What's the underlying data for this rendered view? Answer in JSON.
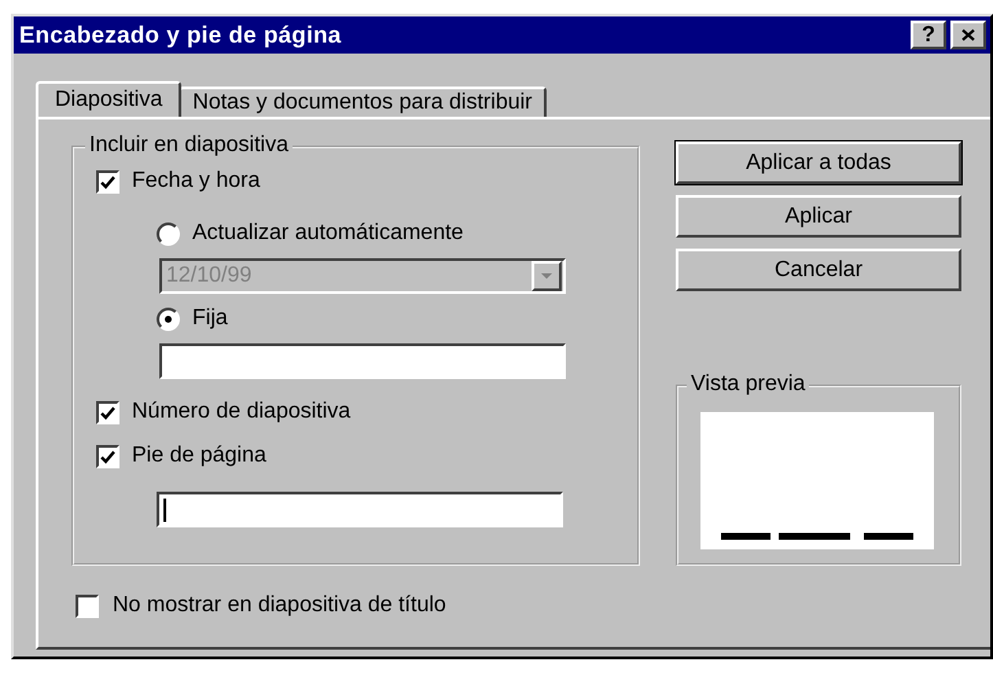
{
  "window": {
    "title": "Encabezado y pie de página",
    "help_button": "?"
  },
  "tabs": [
    {
      "label": "Diapositiva",
      "selected": true
    },
    {
      "label": "Notas y documentos para distribuir",
      "selected": false
    }
  ],
  "group": {
    "title": "Incluir en diapositiva",
    "items": [
      {
        "kind": "checkbox",
        "label": "Fecha y hora",
        "checked": true,
        "children": [
          {
            "kind": "radio",
            "label": "Actualizar automáticamente",
            "selected": false,
            "children": [
              {
                "kind": "dropdown",
                "value": "12/10/99",
                "disabled": true
              }
            ]
          },
          {
            "kind": "radio",
            "label": "Fija",
            "selected": true,
            "children": [
              {
                "kind": "textfield",
                "focused": false
              }
            ]
          }
        ]
      },
      {
        "kind": "checkbox",
        "label": "Número de diapositiva",
        "checked": true
      },
      {
        "kind": "checkbox",
        "label": "Pie de página",
        "checked": true,
        "children": [
          {
            "kind": "textfield",
            "focused": true
          }
        ]
      }
    ]
  },
  "bottom_checkbox": {
    "label": "No mostrar en diapositiva de título",
    "checked": false
  },
  "buttons": [
    {
      "label": "Aplicar a todas",
      "default": true
    },
    {
      "label": "Aplicar",
      "default": false
    },
    {
      "label": "Cancelar",
      "default": false
    }
  ],
  "preview": {
    "title": "Vista previa"
  }
}
